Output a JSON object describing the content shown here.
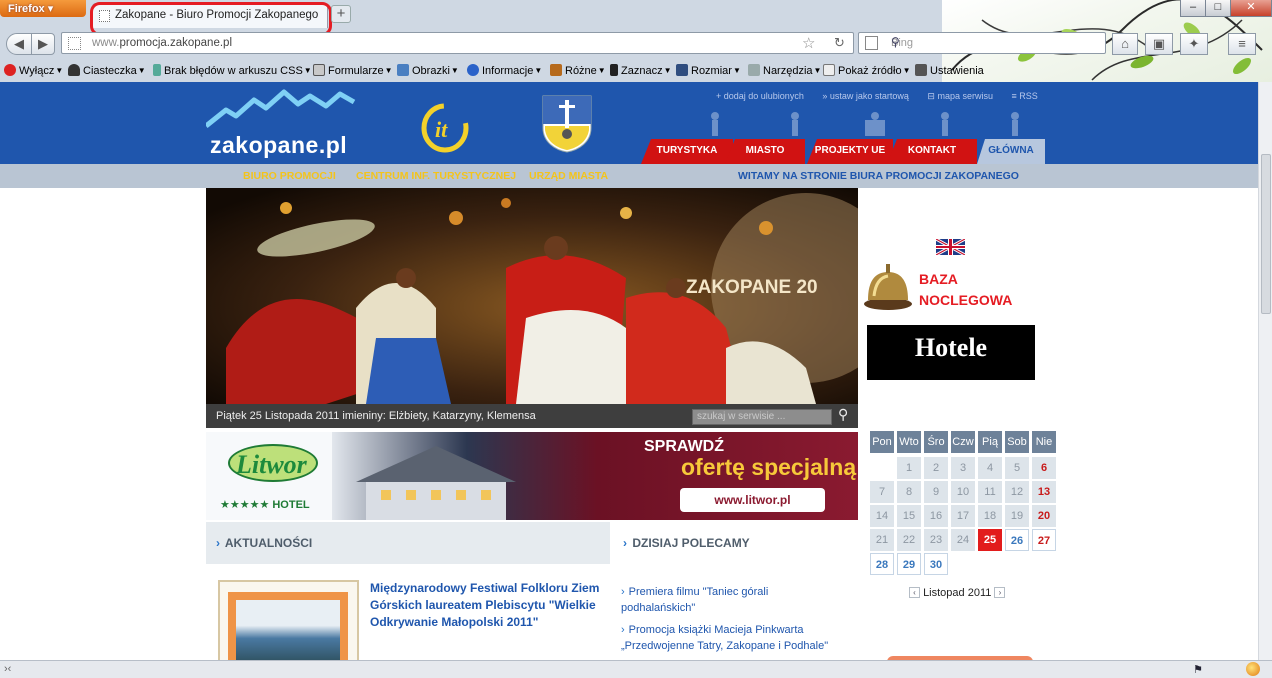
{
  "browser": {
    "app_menu_label": "Firefox",
    "tab_title": "Zakopane - Biuro Promocji Zakopanego",
    "new_tab_label": "+",
    "url_host_prefix": "www.",
    "url_host": "promocja.zakopane.pl",
    "search_placeholder": "Bing",
    "window_buttons": [
      "–",
      "□",
      "✕"
    ],
    "bookmarks": [
      "Wyłącz",
      "Ciasteczka",
      "Brak błędów w arkuszu CSS",
      "Formularze",
      "Obrazki",
      "Informacje",
      "Różne",
      "Zaznacz",
      "Rozmiar",
      "Narzędzia",
      "Pokaż źródło",
      "Ustawienia"
    ]
  },
  "site": {
    "logo_text": "zakopane.pl",
    "cit_text": "it",
    "top_links": [
      "+ dodaj do ulubionych",
      "» ustaw jako startową",
      "⊟ mapa serwisu",
      "≡ RSS"
    ],
    "nav_tabs": [
      "TURYSTYKA",
      "MIASTO",
      "PROJEKTY UE",
      "KONTAKT",
      "GŁÓWNA"
    ],
    "subnav": [
      "BIURO PROMOCJI",
      "CENTRUM INF. TURYSTYCZNEJ",
      "URZĄD MIASTA"
    ],
    "welcome": "WITAMY NA STRONIE BIURA PROMOCJI ZAKOPANEGO",
    "hero_overlay_text": "ZAKOPANE 20",
    "date_line": "Piątek 25 Listopada 2011   imieniny: Elżbiety, Katarzyny, Klemensa",
    "search_placeholder": "szukaj w serwisie ...",
    "banner": {
      "brand": "Litwor",
      "stars": "★★★★★ HOTEL",
      "line1": "SPRAWDŹ",
      "line2": "ofertę specjalną",
      "url": "www.litwor.pl"
    },
    "news_heading": "AKTUALNOŚCI",
    "news_title": "Międzynarodowy Festiwal Folkloru Ziem Górskich laureatem Plebiscytu \"Wielkie Odkrywanie Małopolski 2011\"",
    "recommend_heading": "DZISIAJ POLECAMY",
    "recommend_items": [
      "Premiera filmu \"Taniec górali podhalańskich\"",
      "Promocja książki Macieja Pinkwarta „Przedwojenne Tatry, Zakopane i Podhale\""
    ],
    "baza_line1": "BAZA",
    "baza_line2": "NOCLEGOWA",
    "hotele": "Hotele",
    "calendar": {
      "headers": [
        "Pon",
        "Wto",
        "Śro",
        "Czw",
        "Pią",
        "Sob",
        "Nie"
      ],
      "weeks": [
        [
          "",
          "1",
          "2",
          "3",
          "4",
          "5",
          "6"
        ],
        [
          "7",
          "8",
          "9",
          "10",
          "11",
          "12",
          "13"
        ],
        [
          "14",
          "15",
          "16",
          "17",
          "18",
          "19",
          "20"
        ],
        [
          "21",
          "22",
          "23",
          "24",
          "25",
          "26",
          "27"
        ],
        [
          "28",
          "29",
          "30",
          "",
          "",
          "",
          ""
        ]
      ],
      "today": "25",
      "month_label": "Listopad 2011"
    }
  }
}
